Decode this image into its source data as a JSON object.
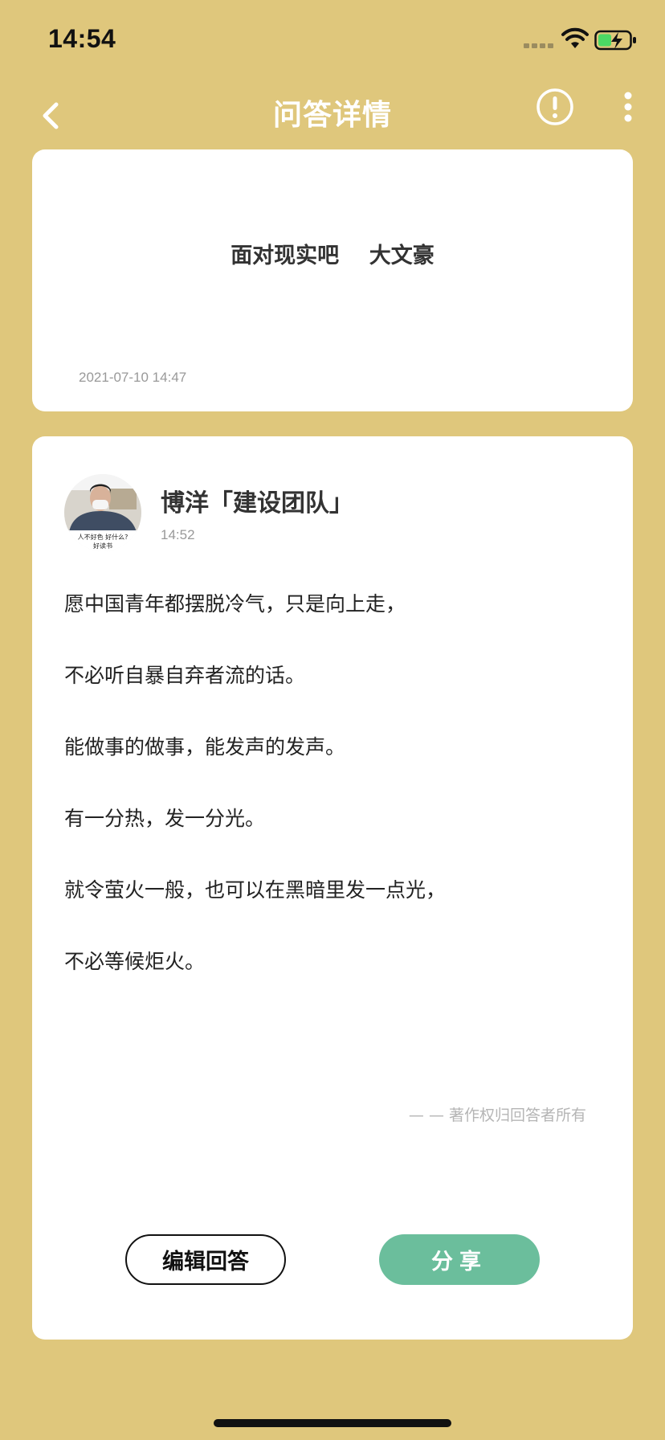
{
  "status_bar": {
    "time": "14:54",
    "icons": [
      "signal-icon",
      "wifi-icon",
      "battery-charging-icon"
    ]
  },
  "nav": {
    "title": "问答详情",
    "icons": [
      "back-chevron-icon",
      "report-icon",
      "more-vertical-icon"
    ]
  },
  "question": {
    "text": "面对现实吧    大文豪",
    "date": "2021-07-10 14:47"
  },
  "answer": {
    "author": "博洋「建设团队」",
    "time": "14:52",
    "avatar_caption_line1": "人不好色 好什么?",
    "avatar_caption_line2": "好读书",
    "lines": [
      "愿中国青年都摆脱冷气，只是向上走，",
      "不必听自暴自弃者流的话。",
      "能做事的做事，能发声的发声。",
      "有一分热，发一分光。",
      "就令萤火一般，也可以在黑暗里发一点光，",
      "不必等候炬火。"
    ],
    "copyright": "— — 著作权归回答者所有"
  },
  "actions": {
    "edit_label": "编辑回答",
    "share_label": "分享"
  },
  "colors": {
    "background": "#DFC77C",
    "card": "#FFFFFF",
    "share_button": "#6BBE9C"
  }
}
